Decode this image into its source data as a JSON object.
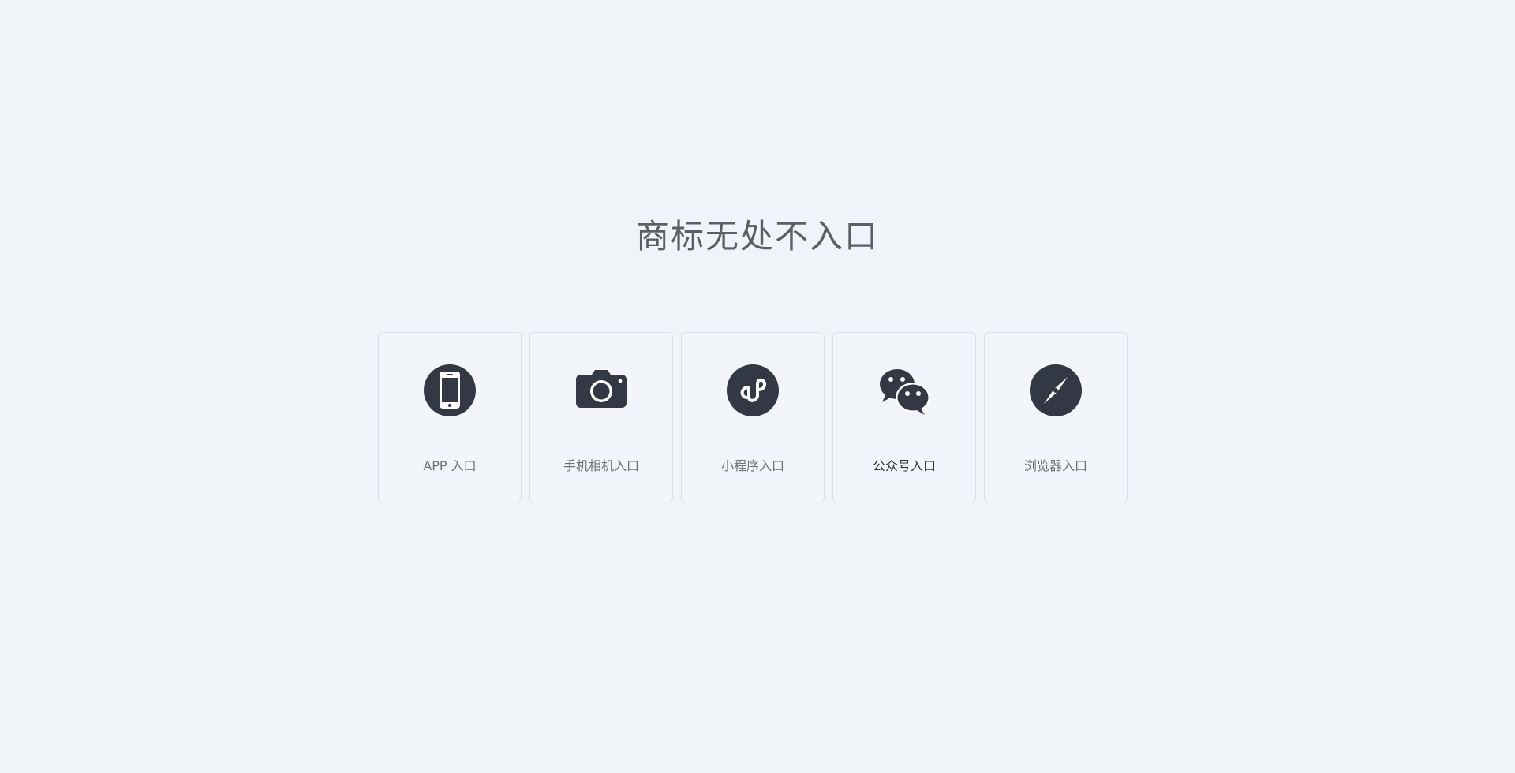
{
  "page": {
    "title": "商标无处不入口"
  },
  "colors": {
    "background": "#f0f3f8",
    "icon": "#333845",
    "card_border": "#dcdfe6",
    "title_text": "#5a5e66",
    "label_text": "#6b6f76"
  },
  "entries": [
    {
      "label": "APP 入口",
      "icon": "smartphone-icon"
    },
    {
      "label": "手机相机入口",
      "icon": "camera-icon"
    },
    {
      "label": "小程序入口",
      "icon": "mini-program-icon"
    },
    {
      "label": "公众号入口",
      "icon": "wechat-icon"
    },
    {
      "label": "浏览器入口",
      "icon": "compass-icon"
    }
  ]
}
